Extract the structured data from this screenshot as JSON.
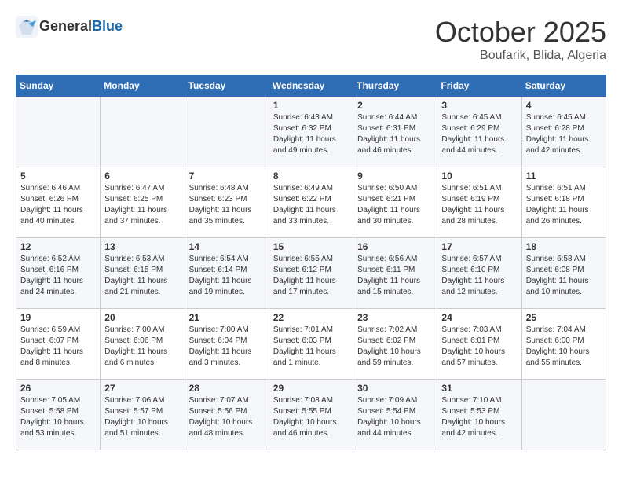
{
  "header": {
    "logo_line1": "General",
    "logo_line2": "Blue",
    "month_title": "October 2025",
    "location": "Boufarik, Blida, Algeria"
  },
  "weekdays": [
    "Sunday",
    "Monday",
    "Tuesday",
    "Wednesday",
    "Thursday",
    "Friday",
    "Saturday"
  ],
  "rows": [
    [
      {
        "day": "",
        "info": ""
      },
      {
        "day": "",
        "info": ""
      },
      {
        "day": "",
        "info": ""
      },
      {
        "day": "1",
        "info": "Sunrise: 6:43 AM\nSunset: 6:32 PM\nDaylight: 11 hours\nand 49 minutes."
      },
      {
        "day": "2",
        "info": "Sunrise: 6:44 AM\nSunset: 6:31 PM\nDaylight: 11 hours\nand 46 minutes."
      },
      {
        "day": "3",
        "info": "Sunrise: 6:45 AM\nSunset: 6:29 PM\nDaylight: 11 hours\nand 44 minutes."
      },
      {
        "day": "4",
        "info": "Sunrise: 6:45 AM\nSunset: 6:28 PM\nDaylight: 11 hours\nand 42 minutes."
      }
    ],
    [
      {
        "day": "5",
        "info": "Sunrise: 6:46 AM\nSunset: 6:26 PM\nDaylight: 11 hours\nand 40 minutes."
      },
      {
        "day": "6",
        "info": "Sunrise: 6:47 AM\nSunset: 6:25 PM\nDaylight: 11 hours\nand 37 minutes."
      },
      {
        "day": "7",
        "info": "Sunrise: 6:48 AM\nSunset: 6:23 PM\nDaylight: 11 hours\nand 35 minutes."
      },
      {
        "day": "8",
        "info": "Sunrise: 6:49 AM\nSunset: 6:22 PM\nDaylight: 11 hours\nand 33 minutes."
      },
      {
        "day": "9",
        "info": "Sunrise: 6:50 AM\nSunset: 6:21 PM\nDaylight: 11 hours\nand 30 minutes."
      },
      {
        "day": "10",
        "info": "Sunrise: 6:51 AM\nSunset: 6:19 PM\nDaylight: 11 hours\nand 28 minutes."
      },
      {
        "day": "11",
        "info": "Sunrise: 6:51 AM\nSunset: 6:18 PM\nDaylight: 11 hours\nand 26 minutes."
      }
    ],
    [
      {
        "day": "12",
        "info": "Sunrise: 6:52 AM\nSunset: 6:16 PM\nDaylight: 11 hours\nand 24 minutes."
      },
      {
        "day": "13",
        "info": "Sunrise: 6:53 AM\nSunset: 6:15 PM\nDaylight: 11 hours\nand 21 minutes."
      },
      {
        "day": "14",
        "info": "Sunrise: 6:54 AM\nSunset: 6:14 PM\nDaylight: 11 hours\nand 19 minutes."
      },
      {
        "day": "15",
        "info": "Sunrise: 6:55 AM\nSunset: 6:12 PM\nDaylight: 11 hours\nand 17 minutes."
      },
      {
        "day": "16",
        "info": "Sunrise: 6:56 AM\nSunset: 6:11 PM\nDaylight: 11 hours\nand 15 minutes."
      },
      {
        "day": "17",
        "info": "Sunrise: 6:57 AM\nSunset: 6:10 PM\nDaylight: 11 hours\nand 12 minutes."
      },
      {
        "day": "18",
        "info": "Sunrise: 6:58 AM\nSunset: 6:08 PM\nDaylight: 11 hours\nand 10 minutes."
      }
    ],
    [
      {
        "day": "19",
        "info": "Sunrise: 6:59 AM\nSunset: 6:07 PM\nDaylight: 11 hours\nand 8 minutes."
      },
      {
        "day": "20",
        "info": "Sunrise: 7:00 AM\nSunset: 6:06 PM\nDaylight: 11 hours\nand 6 minutes."
      },
      {
        "day": "21",
        "info": "Sunrise: 7:00 AM\nSunset: 6:04 PM\nDaylight: 11 hours\nand 3 minutes."
      },
      {
        "day": "22",
        "info": "Sunrise: 7:01 AM\nSunset: 6:03 PM\nDaylight: 11 hours\nand 1 minute."
      },
      {
        "day": "23",
        "info": "Sunrise: 7:02 AM\nSunset: 6:02 PM\nDaylight: 10 hours\nand 59 minutes."
      },
      {
        "day": "24",
        "info": "Sunrise: 7:03 AM\nSunset: 6:01 PM\nDaylight: 10 hours\nand 57 minutes."
      },
      {
        "day": "25",
        "info": "Sunrise: 7:04 AM\nSunset: 6:00 PM\nDaylight: 10 hours\nand 55 minutes."
      }
    ],
    [
      {
        "day": "26",
        "info": "Sunrise: 7:05 AM\nSunset: 5:58 PM\nDaylight: 10 hours\nand 53 minutes."
      },
      {
        "day": "27",
        "info": "Sunrise: 7:06 AM\nSunset: 5:57 PM\nDaylight: 10 hours\nand 51 minutes."
      },
      {
        "day": "28",
        "info": "Sunrise: 7:07 AM\nSunset: 5:56 PM\nDaylight: 10 hours\nand 48 minutes."
      },
      {
        "day": "29",
        "info": "Sunrise: 7:08 AM\nSunset: 5:55 PM\nDaylight: 10 hours\nand 46 minutes."
      },
      {
        "day": "30",
        "info": "Sunrise: 7:09 AM\nSunset: 5:54 PM\nDaylight: 10 hours\nand 44 minutes."
      },
      {
        "day": "31",
        "info": "Sunrise: 7:10 AM\nSunset: 5:53 PM\nDaylight: 10 hours\nand 42 minutes."
      },
      {
        "day": "",
        "info": ""
      }
    ]
  ]
}
